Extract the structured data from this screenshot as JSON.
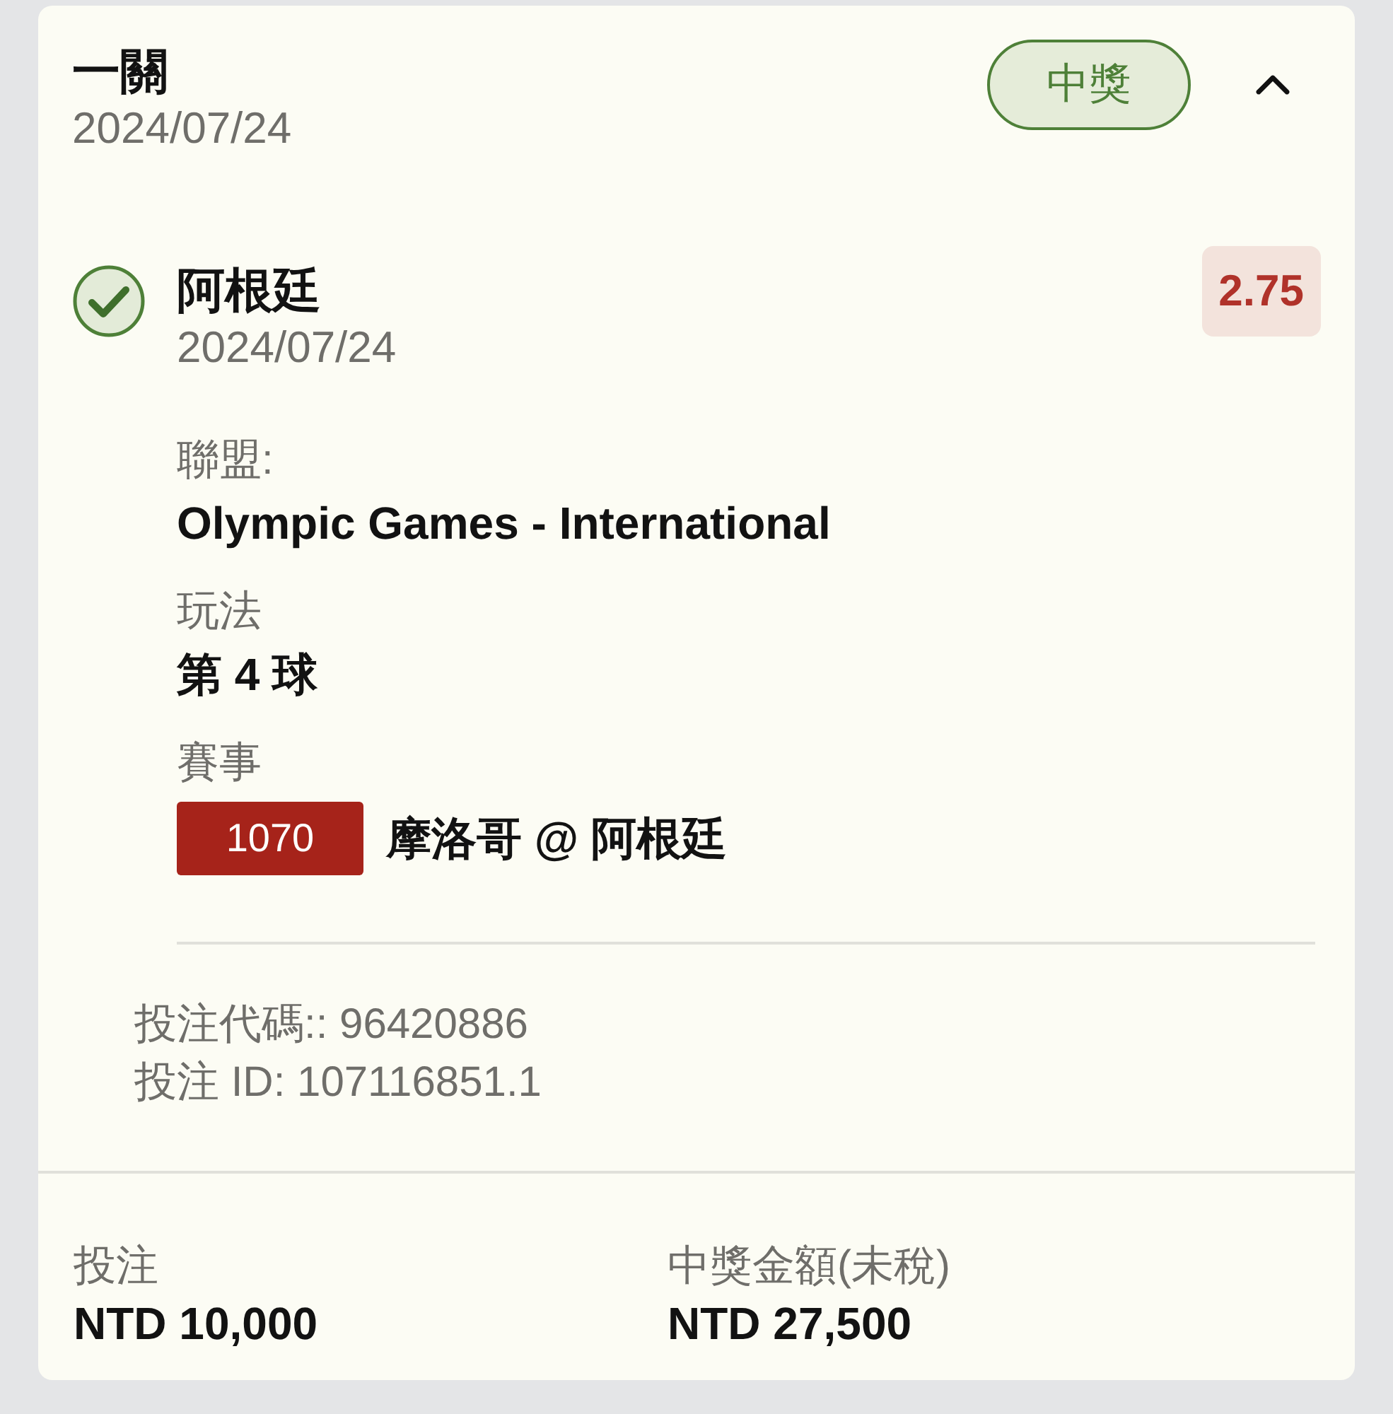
{
  "header": {
    "title": "一關",
    "date": "2024/07/24",
    "status": {
      "label": "中獎",
      "won": true
    },
    "expanded": true
  },
  "selection": {
    "won": true,
    "team": "阿根廷",
    "date": "2024/07/24",
    "odds": "2.75",
    "fields": [
      {
        "label": "聯盟:",
        "value": "Olympic Games - International"
      },
      {
        "label": "玩法",
        "value": "第 4 球"
      }
    ],
    "match": {
      "label": "賽事",
      "number": "1070",
      "teams": "摩洛哥 @ 阿根廷"
    }
  },
  "codes": [
    "投注代碼:: 96420886",
    "投注 ID: 107116851.1"
  ],
  "totals": [
    {
      "label": "投注",
      "value": "NTD 10,000"
    },
    {
      "label": "中獎金額(未稅)",
      "value": "NTD 27,500"
    }
  ]
}
